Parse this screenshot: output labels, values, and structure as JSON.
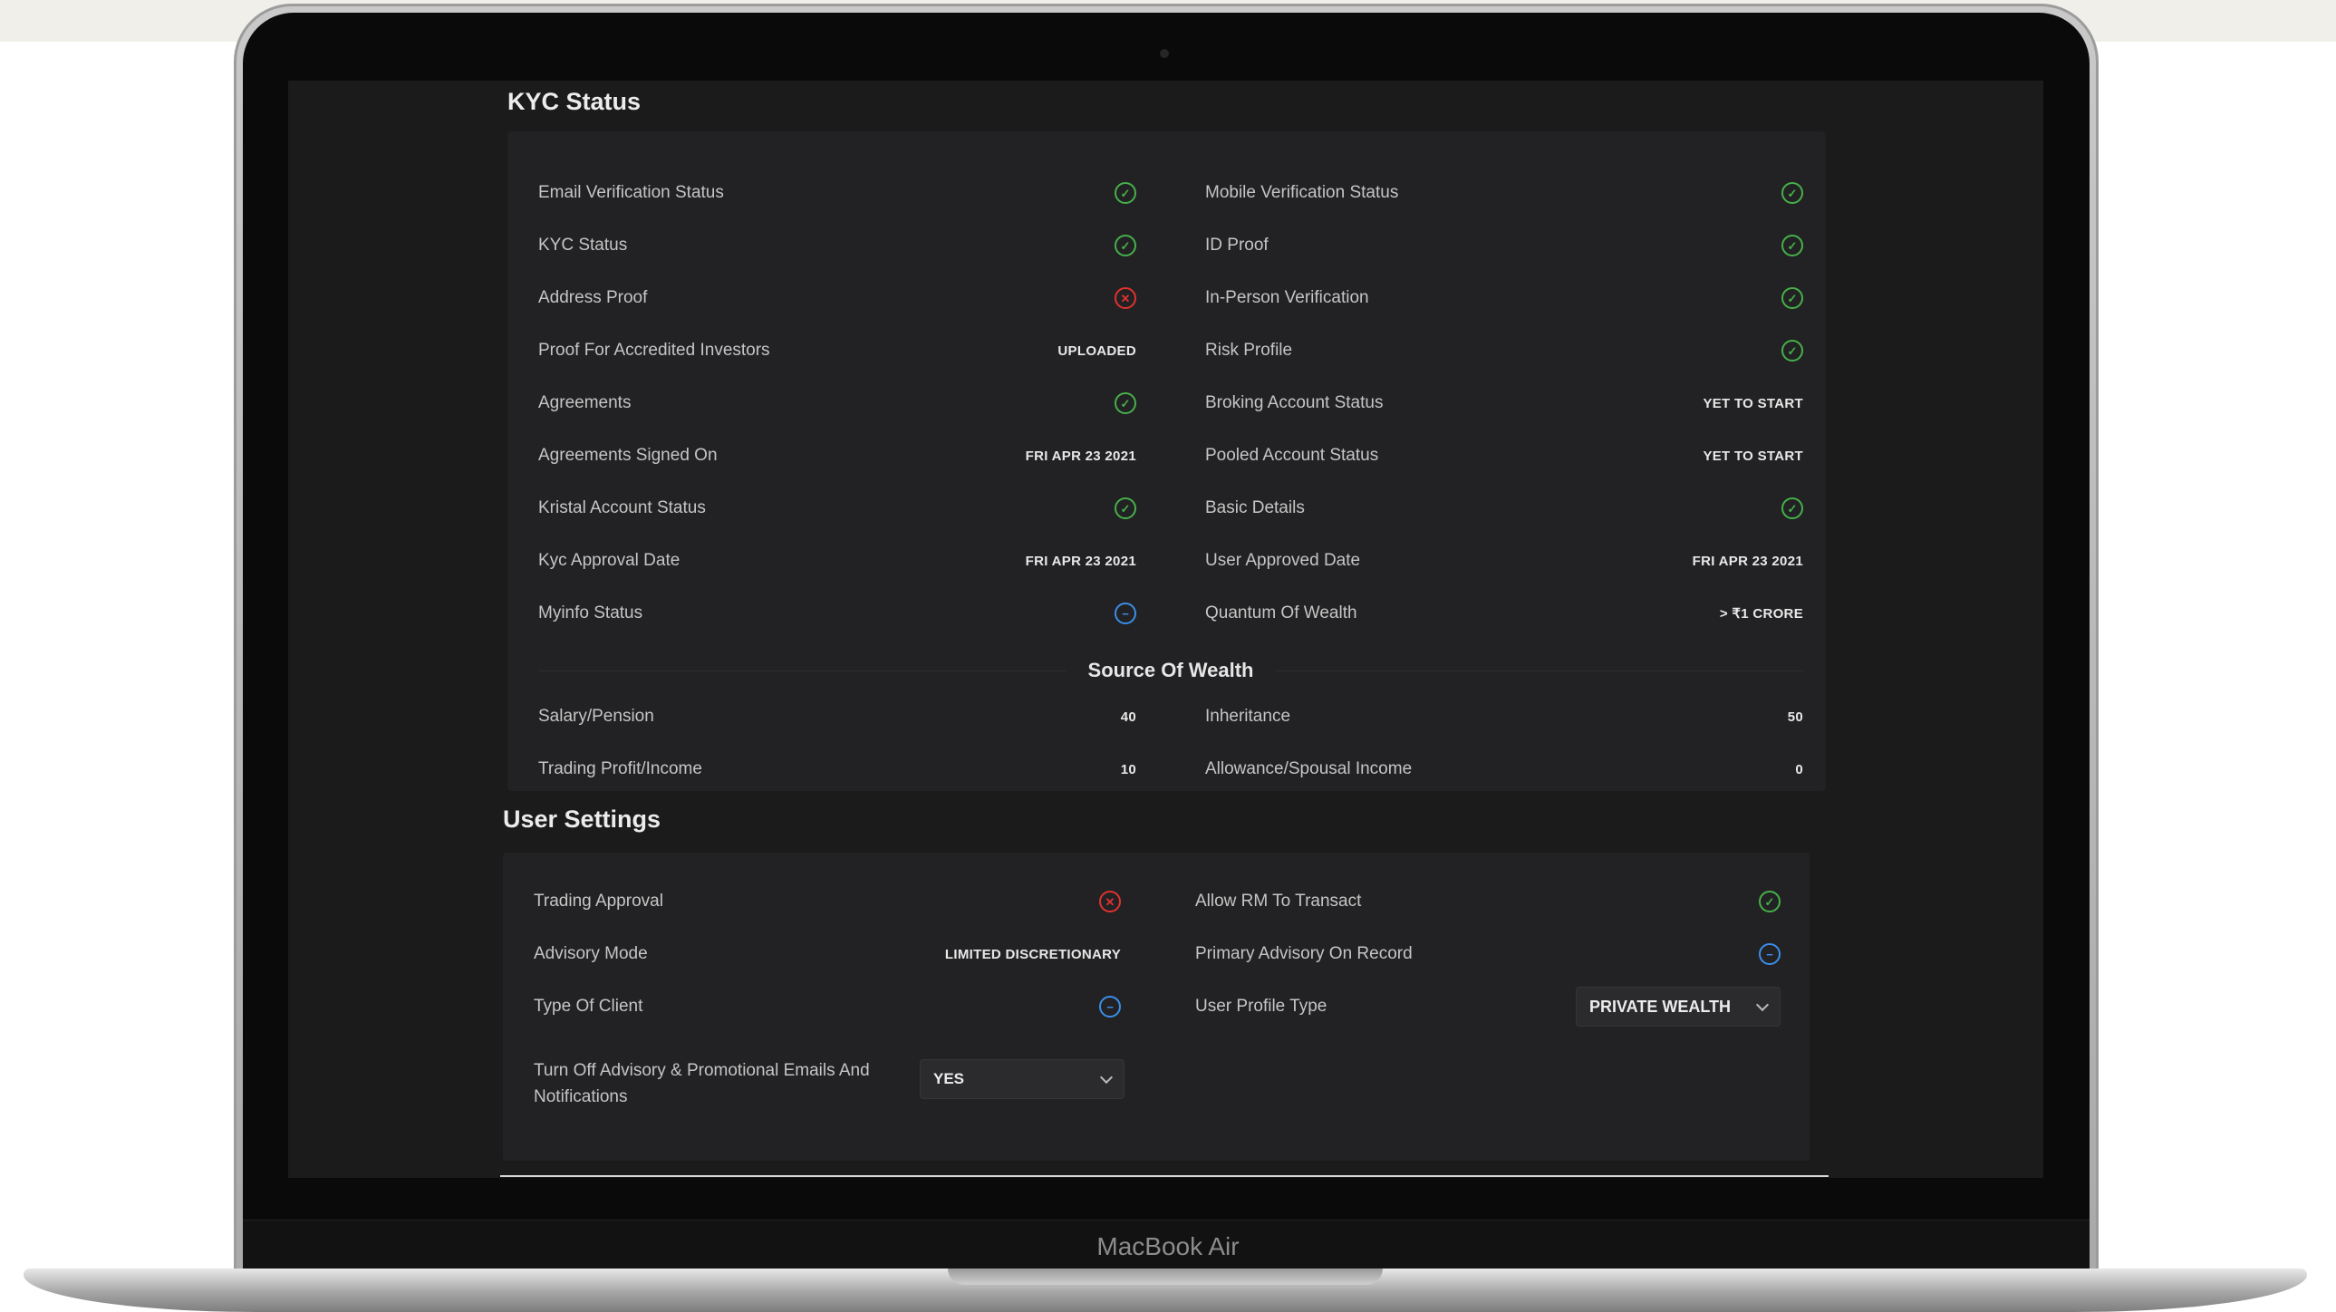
{
  "device": {
    "brand": "MacBook Air"
  },
  "kyc": {
    "title": "KYC Status",
    "left": [
      {
        "label": "Email Verification Status",
        "icon": "check-icon"
      },
      {
        "label": "KYC Status",
        "icon": "check-icon"
      },
      {
        "label": "Address Proof",
        "icon": "cross-icon"
      },
      {
        "label": "Proof For Accredited Investors",
        "value": "UPLOADED"
      },
      {
        "label": "Agreements",
        "icon": "check-icon"
      },
      {
        "label": "Agreements Signed On",
        "value": "FRI APR 23 2021"
      },
      {
        "label": "Kristal Account Status",
        "icon": "check-icon"
      },
      {
        "label": "Kyc Approval Date",
        "value": "FRI APR 23 2021"
      },
      {
        "label": "Myinfo Status",
        "icon": "minus-icon"
      }
    ],
    "right": [
      {
        "label": "Mobile Verification Status",
        "icon": "check-icon"
      },
      {
        "label": "ID Proof",
        "icon": "check-icon"
      },
      {
        "label": "In-Person Verification",
        "icon": "check-icon"
      },
      {
        "label": "Risk Profile",
        "icon": "check-icon"
      },
      {
        "label": "Broking Account Status",
        "value": "YET TO START"
      },
      {
        "label": "Pooled Account Status",
        "value": "YET TO START"
      },
      {
        "label": "Basic Details",
        "icon": "check-icon"
      },
      {
        "label": "User Approved Date",
        "value": "FRI APR 23 2021"
      },
      {
        "label": "Quantum Of Wealth",
        "value": "> ₹1 CRORE"
      }
    ],
    "source_of_wealth": {
      "title": "Source Of Wealth",
      "left": [
        {
          "label": "Salary/Pension",
          "value": "40"
        },
        {
          "label": "Trading Profit/Income",
          "value": "10"
        }
      ],
      "right": [
        {
          "label": "Inheritance",
          "value": "50"
        },
        {
          "label": "Allowance/Spousal Income",
          "value": "0"
        }
      ]
    }
  },
  "user_settings": {
    "title": "User Settings",
    "left": [
      {
        "label": "Trading Approval",
        "icon": "cross-icon"
      },
      {
        "label": "Advisory Mode",
        "value": "LIMITED DISCRETIONARY"
      },
      {
        "label": "Type Of Client",
        "icon": "minus-icon"
      }
    ],
    "right": [
      {
        "label": "Allow RM To Transact",
        "icon": "check-icon"
      },
      {
        "label": "Primary Advisory On Record",
        "icon": "minus-icon"
      },
      {
        "label": "User Profile Type"
      }
    ],
    "email_toggle": {
      "label": "Turn Off Advisory & Promotional Emails And Notifications",
      "selected": "YES"
    },
    "profile_type_selected": "PRIVATE WEALTH"
  },
  "colors": {
    "ok": "#46b04a",
    "error": "#e0322e",
    "info": "#3b8ee8"
  }
}
